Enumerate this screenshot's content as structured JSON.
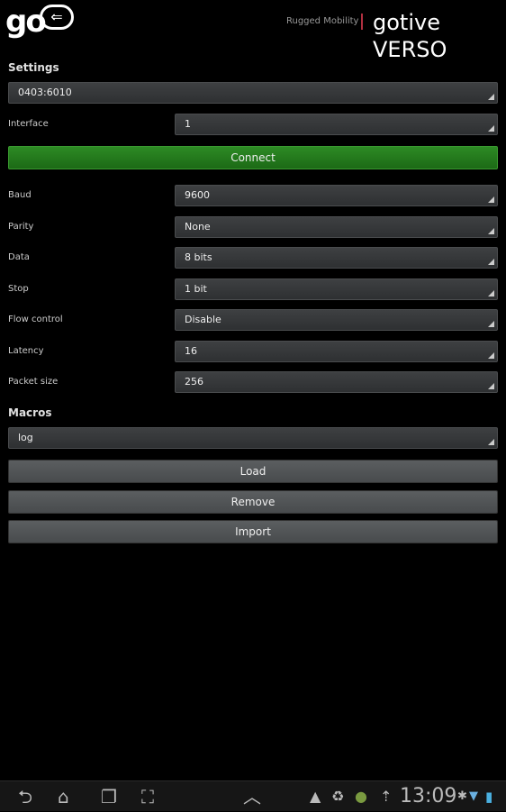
{
  "header": {
    "logo_text": "go",
    "brand_tagline": "Rugged Mobility",
    "brand_name": "gotive VERSO"
  },
  "settings": {
    "title": "Settings",
    "device": "0403:6010",
    "interface": {
      "label": "Interface",
      "value": "1"
    },
    "connect_label": "Connect",
    "rows": [
      {
        "label": "Baud",
        "value": "9600"
      },
      {
        "label": "Parity",
        "value": "None"
      },
      {
        "label": "Data",
        "value": "8 bits"
      },
      {
        "label": "Stop",
        "value": "1 bit"
      },
      {
        "label": "Flow control",
        "value": "Disable"
      },
      {
        "label": "Latency",
        "value": "16"
      },
      {
        "label": "Packet size",
        "value": "256"
      }
    ]
  },
  "macros": {
    "title": "Macros",
    "selected": "log",
    "load_label": "Load",
    "remove_label": "Remove",
    "import_label": "Import"
  },
  "statusbar": {
    "time": "13:09",
    "icons": [
      "back-icon",
      "home-icon",
      "recent-apps-icon",
      "screenshot-icon",
      "chevron-up-icon",
      "warning-icon",
      "recycle-icon",
      "android-icon",
      "upload-icon",
      "bluetooth-icon",
      "wifi-icon",
      "battery-icon"
    ]
  },
  "colors": {
    "connect": "#1f6e18",
    "accent": "#b03040"
  }
}
